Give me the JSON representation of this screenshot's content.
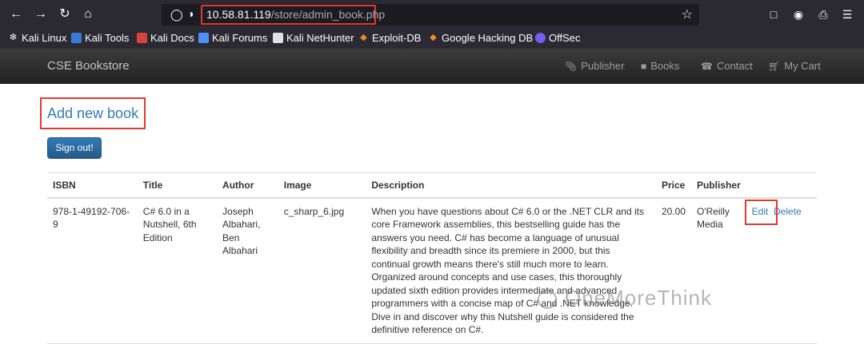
{
  "browser": {
    "url_host": "10.58.81.119",
    "url_path": "/store/admin_book.php",
    "bookmarks": [
      {
        "label": "Kali Linux",
        "color": "#ffffff"
      },
      {
        "label": "Kali Tools",
        "color": "#3a7bd5"
      },
      {
        "label": "Kali Docs",
        "color": "#d9413d"
      },
      {
        "label": "Kali Forums",
        "color": "#4f8ef7"
      },
      {
        "label": "Kali NetHunter",
        "color": "#e0e0e0"
      },
      {
        "label": "Exploit-DB",
        "color": "#f08a24"
      },
      {
        "label": "Google Hacking DB",
        "color": "#f08a24"
      },
      {
        "label": "OffSec",
        "color": "#7b5cf0"
      }
    ]
  },
  "site": {
    "brand": "CSE Bookstore",
    "nav": [
      {
        "label": "Publisher",
        "icon": "paperclip-icon"
      },
      {
        "label": "Books",
        "icon": "book-icon"
      },
      {
        "label": "Contact",
        "icon": "phone-icon"
      },
      {
        "label": "My Cart",
        "icon": "cart-icon"
      }
    ]
  },
  "main": {
    "add_link": "Add new book",
    "signout_label": "Sign out!",
    "table": {
      "headers": [
        "ISBN",
        "Title",
        "Author",
        "Image",
        "Description",
        "Price",
        "Publisher"
      ],
      "rows": [
        {
          "isbn": "978-1-49192-706-9",
          "title": "C# 6.0 in a Nutshell, 6th Edition",
          "author": "Joseph Albahari, Ben Albahari",
          "image": "c_sharp_6.jpg",
          "description": "When you have questions about C# 6.0 or the .NET CLR and its core Framework assemblies, this bestselling guide has the answers you need. C# has become a language of unusual flexibility and breadth since its premiere in 2000, but this continual growth means there's still much more to learn. Organized around concepts and use cases, this thoroughly updated sixth edition provides intermediate and advanced programmers with a concise map of C# and .NET knowledge. Dive in and discover why this Nutshell guide is considered the definitive reference on C#.",
          "price": "20.00",
          "publisher": "O'Reilly Media",
          "edit": "Edit",
          "delete": "Delete"
        }
      ]
    }
  },
  "watermark": "OneMoreThink",
  "colors": {
    "highlight": "#e03a2f",
    "link": "#337ab7",
    "button": "#337ab7"
  }
}
